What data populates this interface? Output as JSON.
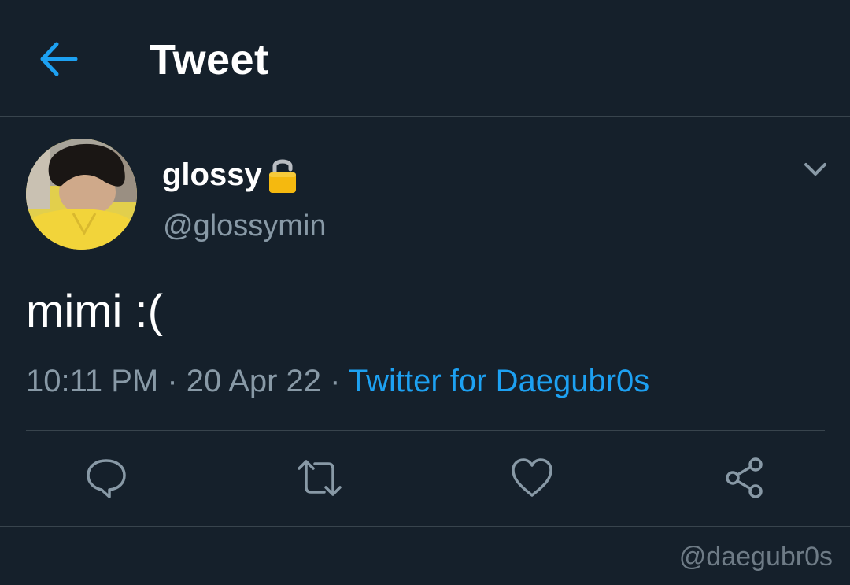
{
  "header": {
    "title": "Tweet",
    "back_icon": "arrow-left-icon",
    "accent_color": "#1da1f2"
  },
  "author": {
    "display_name": "glossy",
    "handle": "@glossymin",
    "protected_icon": "lock-icon"
  },
  "tweet": {
    "text": "mimi :(",
    "time": "10:11 PM",
    "separator1": " · ",
    "date": "20 Apr 22",
    "separator2": " · ",
    "source": "Twitter for Daegubr0s"
  },
  "actions": [
    {
      "name": "reply",
      "icon": "reply-icon"
    },
    {
      "name": "retweet",
      "icon": "retweet-icon"
    },
    {
      "name": "like",
      "icon": "heart-icon"
    },
    {
      "name": "share",
      "icon": "share-icon"
    }
  ],
  "watermark": "@daegubr0s",
  "colors": {
    "background": "#15202b",
    "divider": "#38444d",
    "secondary_text": "#8899a6"
  }
}
